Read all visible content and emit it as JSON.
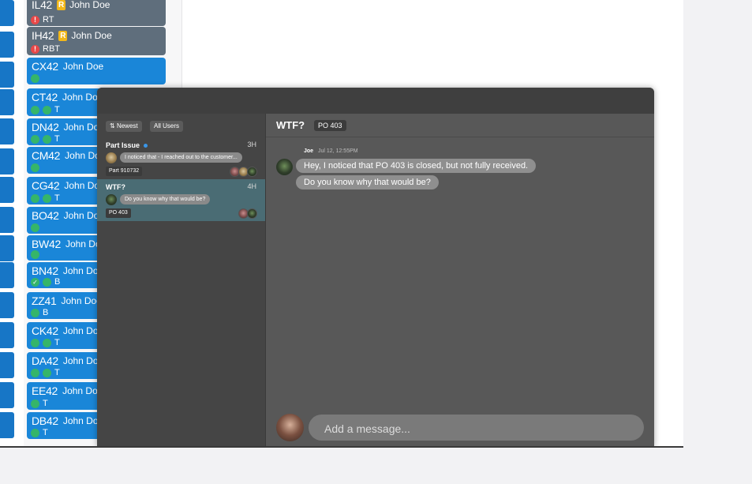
{
  "board": {
    "cards": [
      {
        "code": "IL42",
        "r_badge": "R",
        "name": "John Doe",
        "gray": true,
        "status": "RT",
        "alert": true,
        "dots": 0,
        "check": false
      },
      {
        "code": "IH42",
        "r_badge": "R",
        "name": "John Doe",
        "gray": true,
        "status": "RBT",
        "alert": true,
        "dots": 0,
        "check": false
      },
      {
        "code": "CX42",
        "r_badge": "",
        "name": "John Doe",
        "gray": false,
        "status": "",
        "alert": false,
        "dots": 1,
        "check": false
      },
      {
        "code": "CT42",
        "r_badge": "",
        "name": "John Doe",
        "gray": false,
        "status": "T",
        "alert": false,
        "dots": 2,
        "check": false
      },
      {
        "code": "DN42",
        "r_badge": "",
        "name": "John Doe",
        "gray": false,
        "status": "T",
        "alert": false,
        "dots": 2,
        "check": false
      },
      {
        "code": "CM42",
        "r_badge": "",
        "name": "John Doe",
        "gray": false,
        "status": "",
        "alert": false,
        "dots": 1,
        "check": false
      },
      {
        "code": "CG42",
        "r_badge": "",
        "name": "John Doe",
        "gray": false,
        "status": "T",
        "alert": false,
        "dots": 2,
        "check": false
      },
      {
        "code": "BO42",
        "r_badge": "",
        "name": "John Doe",
        "gray": false,
        "status": "",
        "alert": false,
        "dots": 1,
        "check": false
      },
      {
        "code": "BW42",
        "r_badge": "",
        "name": "John Doe",
        "gray": false,
        "status": "",
        "alert": false,
        "dots": 1,
        "check": false
      },
      {
        "code": "BN42",
        "r_badge": "",
        "name": "John Doe",
        "gray": false,
        "status": "B",
        "alert": false,
        "dots": 1,
        "check": true
      },
      {
        "code": "ZZ41",
        "r_badge": "",
        "name": "John Doe",
        "gray": false,
        "status": "B",
        "alert": false,
        "dots": 1,
        "check": false
      },
      {
        "code": "CK42",
        "r_badge": "",
        "name": "John Doe",
        "gray": false,
        "status": "T",
        "alert": false,
        "dots": 2,
        "check": false
      },
      {
        "code": "DA42",
        "r_badge": "",
        "name": "John Doe",
        "gray": false,
        "status": "T",
        "alert": false,
        "dots": 2,
        "check": false
      },
      {
        "code": "EE42",
        "r_badge": "",
        "name": "John Doe",
        "gray": false,
        "status": "T",
        "alert": false,
        "dots": 1,
        "check": false
      },
      {
        "code": "DB42",
        "r_badge": "",
        "name": "John Doe",
        "gray": false,
        "status": "T",
        "alert": false,
        "dots": 1,
        "check": false
      }
    ]
  },
  "messages": {
    "filters": {
      "sort_label": "Newest",
      "sort_icon": "sort-arrows-icon",
      "users_label": "All Users"
    },
    "conversations": [
      {
        "title": "Part Issue",
        "unread": true,
        "time": "3H",
        "preview": "I noticed that - I reached out to the customer...",
        "tag": "Part 910732",
        "selected": false
      },
      {
        "title": "WTF?",
        "unread": false,
        "time": "4H",
        "preview": "Do you know why that would be?",
        "tag": "PO 403",
        "selected": true
      }
    ],
    "thread": {
      "title": "WTF?",
      "tag": "PO 403",
      "author": "Joe",
      "timestamp": "Jul 12, 12:55PM",
      "bubbles": [
        "Hey, I noticed that PO 403 is closed, but not fully received.",
        "Do you know why that would be?"
      ]
    },
    "composer": {
      "placeholder": "Add a message..."
    }
  },
  "colors": {
    "card_blue": "#1a86d8",
    "card_gray": "#5f6e7c",
    "status_green": "#35b56a",
    "r_badge": "#f2b81a",
    "alert_red": "#e84848",
    "unread_blue": "#3a96e8"
  }
}
